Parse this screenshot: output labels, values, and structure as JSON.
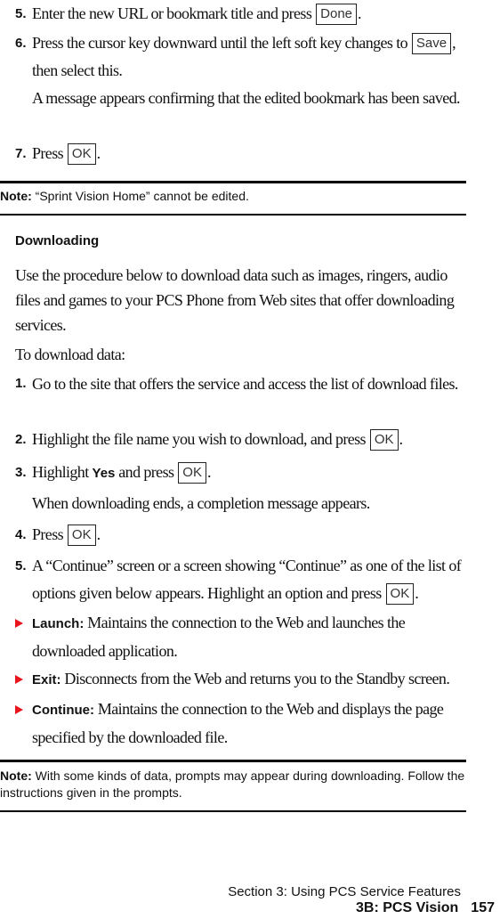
{
  "top_steps": [
    {
      "num": "5.",
      "text": "Enter the new URL or bookmark title and press",
      "key": "Done",
      "after": "."
    },
    {
      "num": "6.",
      "text": "Press the cursor key downward until the left soft key changes to",
      "key": "Save",
      "after": ",",
      "line2": "then select this."
    },
    {
      "note_para": "A message appears confirming that the edited bookmark has been saved."
    },
    {
      "num": "7.",
      "text": "Press",
      "key": "OK",
      "after": "."
    }
  ],
  "note1": {
    "label": "Note:",
    "text": "“Sprint Vision Home” cannot be edited."
  },
  "section": {
    "heading": "Downloading",
    "intro": "Use the procedure below to download data such as images, ringers, audio files and games to your PCS Phone from Web sites that offer downloading services.",
    "lead": "To download data:"
  },
  "steps": [
    {
      "num": "1.",
      "text": "Go to the site that offers the service and access the list of download files."
    },
    {
      "num": "2.",
      "text": "Highlight the file name you wish to download, and press",
      "key": "OK",
      "after": "."
    },
    {
      "num": "3.",
      "pre": "Highlight",
      "bold": "Yes",
      "text": "and press",
      "key": "OK",
      "after": "."
    },
    {
      "para": "When downloading ends, a completion message appears."
    },
    {
      "num": "4.",
      "text": "Press",
      "key": "OK",
      "after": "."
    },
    {
      "num": "5.",
      "text": "A “Continue” screen or a screen showing “Continue” as one of the list of options given below appears. Highlight an option and press",
      "key": "OK",
      "after": "."
    }
  ],
  "options": [
    {
      "label": "Launch:",
      "text": "Maintains the connection to the Web and launches the downloaded application."
    },
    {
      "label": "Exit:",
      "text": "Disconnects from the Web and returns you to the Standby screen."
    },
    {
      "label": "Continue:",
      "text": "Maintains the connection to the Web and displays the page specified by the downloaded file."
    }
  ],
  "note2": {
    "label": "Note:",
    "text": "With some kinds of data, prompts may appear during downloading. Follow the instructions given in the prompts."
  },
  "footer": {
    "section": "Section 3: Using PCS Service Features",
    "chapter": "3B: PCS Vision",
    "page": "157"
  },
  "colors": {
    "bullet": "#e8141e"
  }
}
